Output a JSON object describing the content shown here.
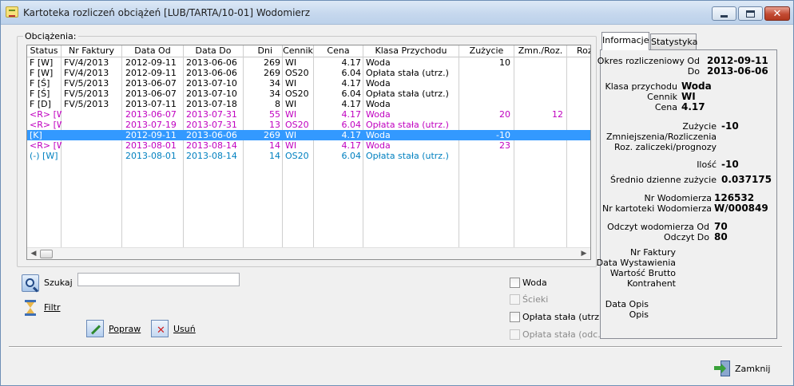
{
  "window": {
    "title": "Kartoteka rozliczeń obciążeń [LUB/TARTA/10-01] Wodomierz"
  },
  "group": {
    "label": "Obciążenia:"
  },
  "grid": {
    "columns": [
      "Status",
      "Nr Faktury",
      "Data Od",
      "Data Do",
      "Dni",
      "Cennik",
      "Cena",
      "Klasa Przychodu",
      "Zużycie",
      "Zmn./Roz.",
      "Roz"
    ],
    "rows": [
      {
        "style": "black",
        "status": "F [W]",
        "nr_faktury": "FV/4/2013",
        "data_od": "2012-09-11",
        "data_do": "2013-06-06",
        "dni": "269",
        "cennik": "WI",
        "cena": "4.17",
        "klasa": "Woda",
        "zuzycie": "10",
        "zmn": ""
      },
      {
        "style": "black",
        "status": "F [W]",
        "nr_faktury": "FV/4/2013",
        "data_od": "2012-09-11",
        "data_do": "2013-06-06",
        "dni": "269",
        "cennik": "OS20",
        "cena": "6.04",
        "klasa": "Opłata stała (utrz.)",
        "zuzycie": "",
        "zmn": ""
      },
      {
        "style": "black",
        "status": "F [Ś]",
        "nr_faktury": "FV/5/2013",
        "data_od": "2013-06-07",
        "data_do": "2013-07-10",
        "dni": "34",
        "cennik": "WI",
        "cena": "4.17",
        "klasa": "Woda",
        "zuzycie": "",
        "zmn": ""
      },
      {
        "style": "black",
        "status": "F [Ś]",
        "nr_faktury": "FV/5/2013",
        "data_od": "2013-06-07",
        "data_do": "2013-07-10",
        "dni": "34",
        "cennik": "OS20",
        "cena": "6.04",
        "klasa": "Opłata stała (utrz.)",
        "zuzycie": "",
        "zmn": ""
      },
      {
        "style": "black",
        "status": "F [D]",
        "nr_faktury": "FV/5/2013",
        "data_od": "2013-07-11",
        "data_do": "2013-07-18",
        "dni": "8",
        "cennik": "WI",
        "cena": "4.17",
        "klasa": "Woda",
        "zuzycie": "",
        "zmn": ""
      },
      {
        "style": "magenta",
        "status": "<R> [W]",
        "nr_faktury": "",
        "data_od": "2013-06-07",
        "data_do": "2013-07-31",
        "dni": "55",
        "cennik": "WI",
        "cena": "4.17",
        "klasa": "Woda",
        "zuzycie": "20",
        "zmn": "12"
      },
      {
        "style": "magenta",
        "status": "<R> [W]",
        "nr_faktury": "",
        "data_od": "2013-07-19",
        "data_do": "2013-07-31",
        "dni": "13",
        "cennik": "OS20",
        "cena": "6.04",
        "klasa": "Opłata stała (utrz.)",
        "zuzycie": "",
        "zmn": ""
      },
      {
        "style": "selected",
        "status": "[K]",
        "nr_faktury": "",
        "data_od": "2012-09-11",
        "data_do": "2013-06-06",
        "dni": "269",
        "cennik": "WI",
        "cena": "4.17",
        "klasa": "Woda",
        "zuzycie": "-10",
        "zmn": ""
      },
      {
        "style": "magenta",
        "status": "<R> [W]",
        "nr_faktury": "",
        "data_od": "2013-08-01",
        "data_do": "2013-08-14",
        "dni": "14",
        "cennik": "WI",
        "cena": "4.17",
        "klasa": "Woda",
        "zuzycie": "23",
        "zmn": ""
      },
      {
        "style": "teal",
        "status": "(-) [W]",
        "nr_faktury": "",
        "data_od": "2013-08-01",
        "data_do": "2013-08-14",
        "dni": "14",
        "cennik": "OS20",
        "cena": "6.04",
        "klasa": "Opłata stała (utrz.)",
        "zuzycie": "",
        "zmn": ""
      }
    ]
  },
  "tools": {
    "search_label": "Szukaj",
    "search_value": "",
    "filter_label": "Filtr",
    "edit_label": "Popraw",
    "delete_label": "Usuń"
  },
  "checkboxes": [
    {
      "label": "Woda",
      "enabled": true
    },
    {
      "label": "Ścieki",
      "enabled": false
    },
    {
      "label": "Opłata stała (utrz.)",
      "enabled": true
    },
    {
      "label": "Opłata stała (odc.)",
      "enabled": false
    }
  ],
  "tabs": [
    "Informacje",
    "Statystyka"
  ],
  "info": {
    "okres_label": "Okres rozliczeniowy Od",
    "okres_od": "2012-09-11",
    "do_label": "Do",
    "okres_do": "2013-06-06",
    "klasa_label": "Klasa przychodu",
    "klasa": "Woda",
    "cennik_label": "Cennik",
    "cennik": "WI",
    "cena_label": "Cena",
    "cena": "4.17",
    "zuzycie_label": "Zużycie",
    "zuzycie": "-10",
    "zmniejszenia_label": "Zmniejszenia/Rozliczenia",
    "roz_label": "Roz. zaliczeki/prognozy",
    "ilosc_label": "Ilość",
    "ilosc": "-10",
    "srednio_label": "Średnio dzienne zużycie",
    "srednio": "0.037175",
    "nr_wod_label": "Nr Wodomierza",
    "nr_wod": "126532",
    "nr_kart_label": "Nr kartoteki Wodomierza",
    "nr_kart": "W/000849",
    "odczyt_od_label": "Odczyt wodomierza Od",
    "odczyt_od": "70",
    "odczyt_do_label": "Odczyt Do",
    "odczyt_do": "80",
    "nr_faktury_label": "Nr Faktury",
    "data_wyst_label": "Data Wystawienia",
    "wartosc_label": "Wartość Brutto",
    "kontrahent_label": "Kontrahent",
    "data_opis_label": "Data Opis",
    "opis_label": "Opis"
  },
  "footer": {
    "close_label": "Zamknij"
  }
}
